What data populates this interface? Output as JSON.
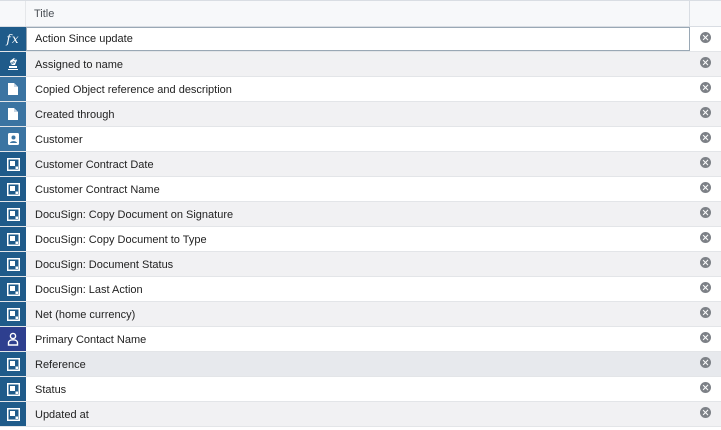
{
  "header": {
    "title_label": "Title"
  },
  "rows": [
    {
      "label": "Action Since update",
      "icon": "function-icon",
      "icon_bg": "#1f5b8a",
      "editing": true
    },
    {
      "label": "Assigned to name",
      "icon": "stamp-icon",
      "icon_bg": "#1f5b8a"
    },
    {
      "label": "Copied Object reference and description",
      "icon": "document-icon",
      "icon_bg": "#3b74a2"
    },
    {
      "label": "Created through",
      "icon": "document-icon",
      "icon_bg": "#3b74a2"
    },
    {
      "label": "Customer",
      "icon": "customer-card-icon",
      "icon_bg": "#3b74a2"
    },
    {
      "label": "Customer Contract Date",
      "icon": "field-icon",
      "icon_bg": "#1f5b8a"
    },
    {
      "label": "Customer Contract Name",
      "icon": "field-icon",
      "icon_bg": "#1f5b8a"
    },
    {
      "label": "DocuSign: Copy Document on Signature",
      "icon": "field-icon",
      "icon_bg": "#1f5b8a"
    },
    {
      "label": "DocuSign: Copy Document to Type",
      "icon": "field-icon",
      "icon_bg": "#1f5b8a"
    },
    {
      "label": "DocuSign: Document Status",
      "icon": "field-icon",
      "icon_bg": "#1f5b8a"
    },
    {
      "label": "DocuSign: Last Action",
      "icon": "field-icon",
      "icon_bg": "#1f5b8a"
    },
    {
      "label": "Net (home currency)",
      "icon": "field-icon",
      "icon_bg": "#1f5b8a"
    },
    {
      "label": "Primary Contact Name",
      "icon": "person-icon",
      "icon_bg": "#2e3f8f"
    },
    {
      "label": "Reference",
      "icon": "field-icon",
      "icon_bg": "#1f5b8a",
      "highlight": true
    },
    {
      "label": "Status",
      "icon": "field-icon",
      "icon_bg": "#1f5b8a"
    },
    {
      "label": "Updated at",
      "icon": "field-icon",
      "icon_bg": "#1f5b8a"
    }
  ]
}
